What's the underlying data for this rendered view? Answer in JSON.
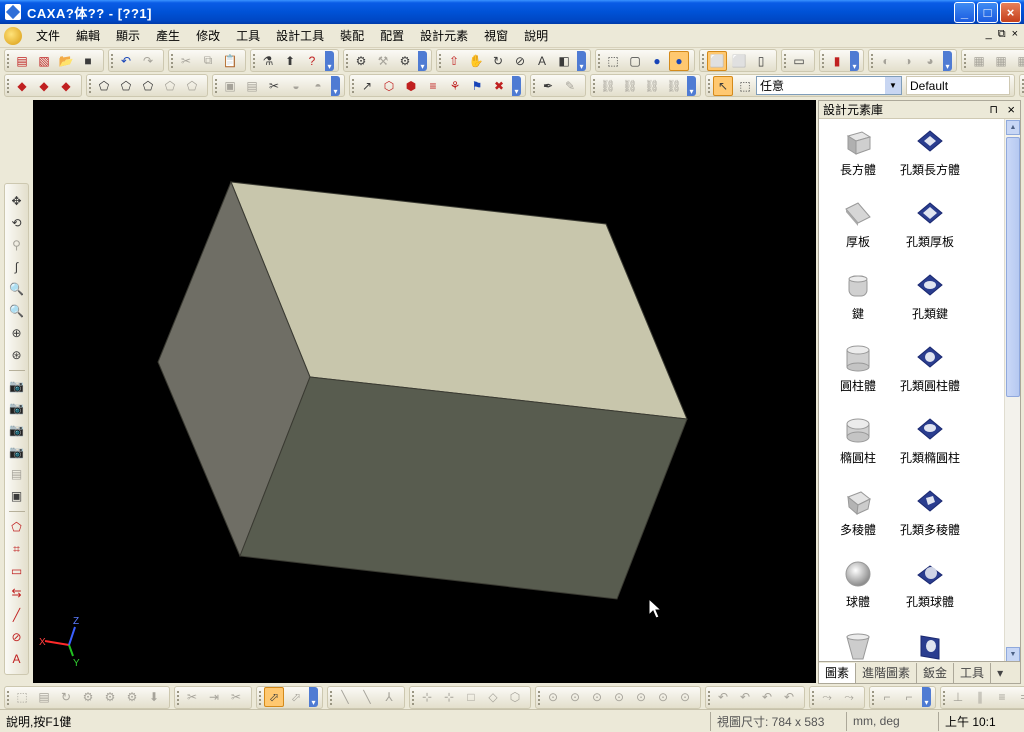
{
  "window": {
    "title": "CAXA?体?? - [??1]",
    "minimize": "_",
    "maximize": "□",
    "close": "×"
  },
  "menu": {
    "items": [
      "文件",
      "編輯",
      "顯示",
      "產生",
      "修改",
      "工具",
      "設計工具",
      "裝配",
      "配置",
      "設計元素",
      "視窗",
      "說明"
    ],
    "mdi_min": "_",
    "mdi_restore": "⧉",
    "mdi_close": "×"
  },
  "toolbar2": {
    "selection_mode": "任意",
    "style": "Default"
  },
  "panel": {
    "title": "設計元素庫",
    "pin": "⊓",
    "close": "×",
    "items": [
      {
        "label": "長方體",
        "icon": "box-icon"
      },
      {
        "label": "孔類長方體",
        "icon": "box-hole-icon"
      },
      {
        "label": "厚板",
        "icon": "plate-icon"
      },
      {
        "label": "孔類厚板",
        "icon": "plate-hole-icon"
      },
      {
        "label": "鍵",
        "icon": "key-icon"
      },
      {
        "label": "孔類鍵",
        "icon": "key-hole-icon"
      },
      {
        "label": "圓柱體",
        "icon": "cylinder-icon"
      },
      {
        "label": "孔類圓柱體",
        "icon": "cylinder-hole-icon"
      },
      {
        "label": "橢圓柱",
        "icon": "elliptic-cylinder-icon"
      },
      {
        "label": "孔類橢圓柱",
        "icon": "elliptic-cylinder-hole-icon"
      },
      {
        "label": "多稜體",
        "icon": "prism-icon"
      },
      {
        "label": "孔類多稜體",
        "icon": "prism-hole-icon"
      },
      {
        "label": "球體",
        "icon": "sphere-icon"
      },
      {
        "label": "孔類球體",
        "icon": "sphere-hole-icon"
      },
      {
        "label": "",
        "icon": "cone-icon"
      },
      {
        "label": "",
        "icon": "cone-hole-icon"
      }
    ],
    "tabs": [
      "圖素",
      "進階圖素",
      "鈑金",
      "工具"
    ],
    "active_tab": "圖素",
    "tab_more": "▾"
  },
  "axis": {
    "x_label": "X",
    "y_label": "Y",
    "z_label": "Z"
  },
  "status": {
    "help": "說明,按F1健",
    "view_size": "視圖尺寸:  784 x 583",
    "units": "mm, deg",
    "time": "上午 10:1"
  },
  "colors": {
    "viewport_bg": "#000000",
    "box_top": "#c8c6ac",
    "box_front": "#585c4f",
    "box_side": "#6f6e65",
    "titlebar": "#0052d6",
    "selected": "#ffc870"
  }
}
